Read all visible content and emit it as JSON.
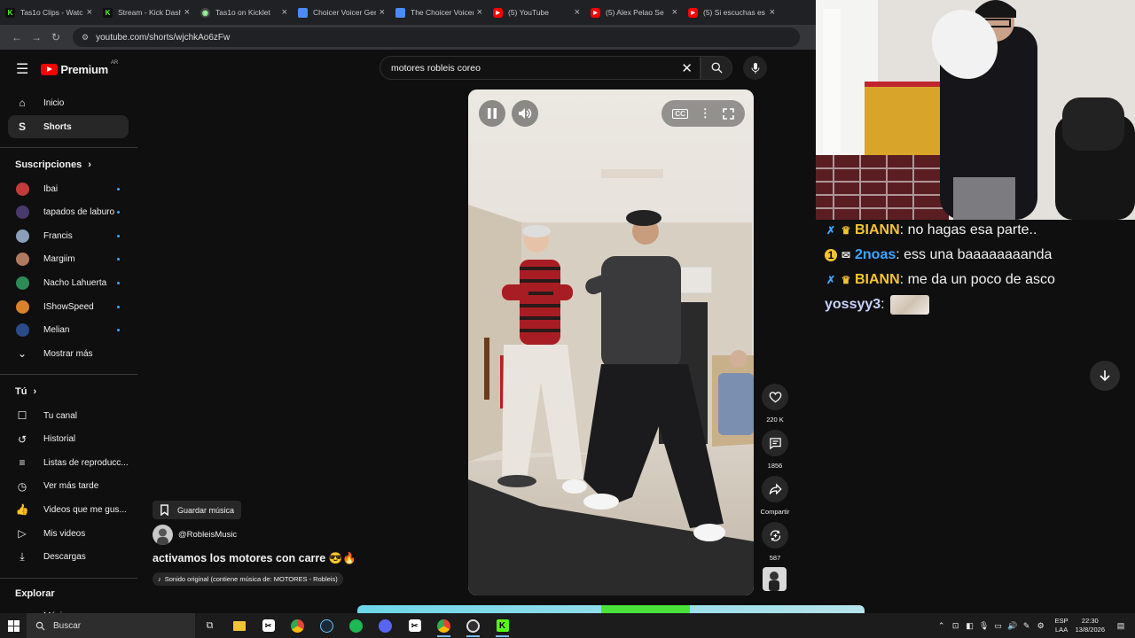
{
  "browser": {
    "tabs": [
      {
        "title": "Tas1o Clips - Watc",
        "favicon": "kick"
      },
      {
        "title": "Stream - Kick Dash",
        "favicon": "kick"
      },
      {
        "title": "Tas1o on Kicklet",
        "favicon": "kicklet"
      },
      {
        "title": "Choicer Voicer Gen",
        "favicon": "doc"
      },
      {
        "title": "The Choicer Voicer",
        "favicon": "doc"
      },
      {
        "title": "(5) YouTube",
        "favicon": "youtube"
      },
      {
        "title": "(5) Alex Pelao Se",
        "favicon": "youtube"
      },
      {
        "title": "(5) Si escuchas es",
        "favicon": "youtube"
      }
    ],
    "url": "youtube.com/shorts/wjchkAo6zFw"
  },
  "youtube": {
    "brand": "Premium",
    "region": "AR",
    "nav": [
      {
        "label": "Inicio",
        "icon": "home-icon"
      },
      {
        "label": "Shorts",
        "icon": "shorts-icon",
        "selected": true
      }
    ],
    "subscriptions_title": "Suscripciones",
    "subscriptions": [
      {
        "label": "Ibai",
        "color": "#c23b3b"
      },
      {
        "label": "tapados de laburo",
        "color": "#4a3a6a"
      },
      {
        "label": "Francis",
        "color": "#8aa0b8"
      },
      {
        "label": "Margiim",
        "color": "#b07a60"
      },
      {
        "label": "Nacho Lahuerta",
        "color": "#2e8b57"
      },
      {
        "label": "IShowSpeed",
        "color": "#d9822b"
      },
      {
        "label": "Melian",
        "color": "#2a4a8a"
      }
    ],
    "show_more": "Mostrar más",
    "you_title": "Tú",
    "you_items": [
      {
        "label": "Tu canal",
        "icon": "account-icon"
      },
      {
        "label": "Historial",
        "icon": "history-icon"
      },
      {
        "label": "Listas de reproducc...",
        "icon": "playlist-icon"
      },
      {
        "label": "Ver más tarde",
        "icon": "clock-icon"
      },
      {
        "label": "Videos que me gus...",
        "icon": "like-icon"
      },
      {
        "label": "Mis videos",
        "icon": "video-icon"
      },
      {
        "label": "Descargas",
        "icon": "download-icon"
      }
    ],
    "explore_title": "Explorar",
    "explore_items": [
      {
        "label": "Música",
        "icon": "music-icon"
      }
    ],
    "search_query": "motores robleis coreo",
    "actions": {
      "likes": "220 K",
      "comments": "1856",
      "share": "Compartir",
      "remix": "587"
    },
    "save_music": "Guardar música",
    "channel": "@RobleisMusic",
    "title": "activamos los motores con carre 😎🔥",
    "sound": "Sonido original (contiene música de: MOTORES - Robleis)"
  },
  "chat": [
    {
      "user": "BIANN",
      "text": ": no hagas esa parte..",
      "color": "#f4c430",
      "badges": [
        "sword",
        "crown"
      ]
    },
    {
      "user": "2noas",
      "text": ": ess una baaaaaaaanda",
      "color": "#3ea6ff",
      "badges": [
        "coin",
        "gift"
      ]
    },
    {
      "user": "BIANN",
      "text": ": me da un poco de asco",
      "color": "#f4c430",
      "badges": [
        "sword",
        "crown"
      ]
    },
    {
      "user": "yossyy3",
      "text": ":",
      "color": "#c7d2ff",
      "badges": [],
      "emote": true
    }
  ],
  "taskbar": {
    "search": "Buscar",
    "lang": "ESP",
    "layout": "LAA",
    "time": "22:30",
    "date": "13/8/2026"
  }
}
